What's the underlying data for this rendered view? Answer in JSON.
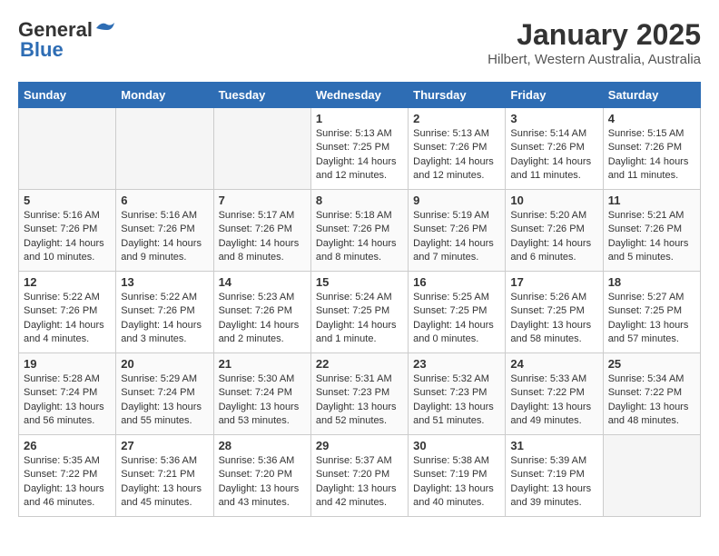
{
  "header": {
    "logo_line1": "General",
    "logo_line2": "Blue",
    "title": "January 2025",
    "subtitle": "Hilbert, Western Australia, Australia"
  },
  "weekdays": [
    "Sunday",
    "Monday",
    "Tuesday",
    "Wednesday",
    "Thursday",
    "Friday",
    "Saturday"
  ],
  "weeks": [
    [
      null,
      null,
      null,
      {
        "day": "1",
        "sunrise": "5:13 AM",
        "sunset": "7:25 PM",
        "daylight": "14 hours and 12 minutes."
      },
      {
        "day": "2",
        "sunrise": "5:13 AM",
        "sunset": "7:26 PM",
        "daylight": "14 hours and 12 minutes."
      },
      {
        "day": "3",
        "sunrise": "5:14 AM",
        "sunset": "7:26 PM",
        "daylight": "14 hours and 11 minutes."
      },
      {
        "day": "4",
        "sunrise": "5:15 AM",
        "sunset": "7:26 PM",
        "daylight": "14 hours and 11 minutes."
      }
    ],
    [
      {
        "day": "5",
        "sunrise": "5:16 AM",
        "sunset": "7:26 PM",
        "daylight": "14 hours and 10 minutes."
      },
      {
        "day": "6",
        "sunrise": "5:16 AM",
        "sunset": "7:26 PM",
        "daylight": "14 hours and 9 minutes."
      },
      {
        "day": "7",
        "sunrise": "5:17 AM",
        "sunset": "7:26 PM",
        "daylight": "14 hours and 8 minutes."
      },
      {
        "day": "8",
        "sunrise": "5:18 AM",
        "sunset": "7:26 PM",
        "daylight": "14 hours and 8 minutes."
      },
      {
        "day": "9",
        "sunrise": "5:19 AM",
        "sunset": "7:26 PM",
        "daylight": "14 hours and 7 minutes."
      },
      {
        "day": "10",
        "sunrise": "5:20 AM",
        "sunset": "7:26 PM",
        "daylight": "14 hours and 6 minutes."
      },
      {
        "day": "11",
        "sunrise": "5:21 AM",
        "sunset": "7:26 PM",
        "daylight": "14 hours and 5 minutes."
      }
    ],
    [
      {
        "day": "12",
        "sunrise": "5:22 AM",
        "sunset": "7:26 PM",
        "daylight": "14 hours and 4 minutes."
      },
      {
        "day": "13",
        "sunrise": "5:22 AM",
        "sunset": "7:26 PM",
        "daylight": "14 hours and 3 minutes."
      },
      {
        "day": "14",
        "sunrise": "5:23 AM",
        "sunset": "7:26 PM",
        "daylight": "14 hours and 2 minutes."
      },
      {
        "day": "15",
        "sunrise": "5:24 AM",
        "sunset": "7:25 PM",
        "daylight": "14 hours and 1 minute."
      },
      {
        "day": "16",
        "sunrise": "5:25 AM",
        "sunset": "7:25 PM",
        "daylight": "14 hours and 0 minutes."
      },
      {
        "day": "17",
        "sunrise": "5:26 AM",
        "sunset": "7:25 PM",
        "daylight": "13 hours and 58 minutes."
      },
      {
        "day": "18",
        "sunrise": "5:27 AM",
        "sunset": "7:25 PM",
        "daylight": "13 hours and 57 minutes."
      }
    ],
    [
      {
        "day": "19",
        "sunrise": "5:28 AM",
        "sunset": "7:24 PM",
        "daylight": "13 hours and 56 minutes."
      },
      {
        "day": "20",
        "sunrise": "5:29 AM",
        "sunset": "7:24 PM",
        "daylight": "13 hours and 55 minutes."
      },
      {
        "day": "21",
        "sunrise": "5:30 AM",
        "sunset": "7:24 PM",
        "daylight": "13 hours and 53 minutes."
      },
      {
        "day": "22",
        "sunrise": "5:31 AM",
        "sunset": "7:23 PM",
        "daylight": "13 hours and 52 minutes."
      },
      {
        "day": "23",
        "sunrise": "5:32 AM",
        "sunset": "7:23 PM",
        "daylight": "13 hours and 51 minutes."
      },
      {
        "day": "24",
        "sunrise": "5:33 AM",
        "sunset": "7:22 PM",
        "daylight": "13 hours and 49 minutes."
      },
      {
        "day": "25",
        "sunrise": "5:34 AM",
        "sunset": "7:22 PM",
        "daylight": "13 hours and 48 minutes."
      }
    ],
    [
      {
        "day": "26",
        "sunrise": "5:35 AM",
        "sunset": "7:22 PM",
        "daylight": "13 hours and 46 minutes."
      },
      {
        "day": "27",
        "sunrise": "5:36 AM",
        "sunset": "7:21 PM",
        "daylight": "13 hours and 45 minutes."
      },
      {
        "day": "28",
        "sunrise": "5:36 AM",
        "sunset": "7:20 PM",
        "daylight": "13 hours and 43 minutes."
      },
      {
        "day": "29",
        "sunrise": "5:37 AM",
        "sunset": "7:20 PM",
        "daylight": "13 hours and 42 minutes."
      },
      {
        "day": "30",
        "sunrise": "5:38 AM",
        "sunset": "7:19 PM",
        "daylight": "13 hours and 40 minutes."
      },
      {
        "day": "31",
        "sunrise": "5:39 AM",
        "sunset": "7:19 PM",
        "daylight": "13 hours and 39 minutes."
      },
      null
    ]
  ]
}
